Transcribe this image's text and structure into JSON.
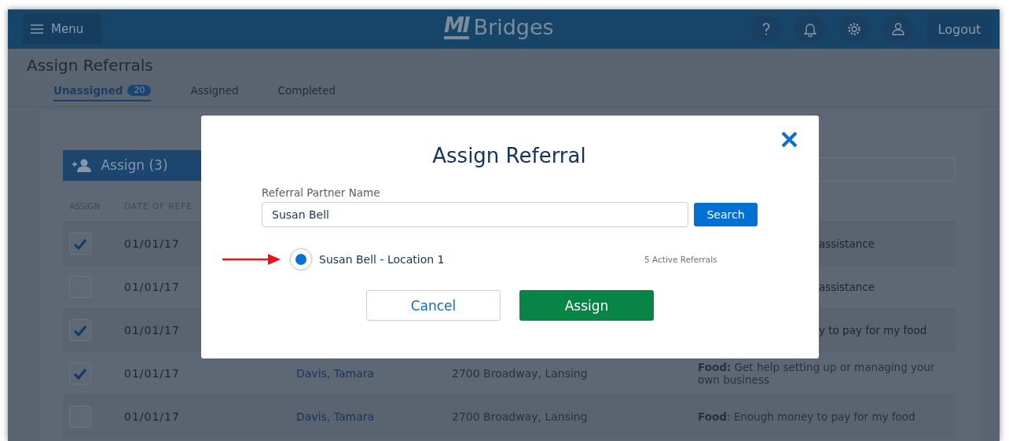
{
  "header": {
    "menu_label": "Menu",
    "logo": {
      "mark": "MI",
      "name": "Bridges"
    },
    "logout_label": "Logout"
  },
  "page_title": "Assign Referrals",
  "tabs": [
    {
      "label": "Unassigned",
      "badge": "20",
      "selected": true
    },
    {
      "label": "Assigned",
      "selected": false
    },
    {
      "label": "Completed",
      "selected": false
    }
  ],
  "assign_button": "Assign (3)",
  "table": {
    "columns": [
      "ASSIGN",
      "DATE OF REFE"
    ],
    "rows": [
      {
        "kind": "partly_hidden",
        "checked": true,
        "date": "01/01/17",
        "description": "assistance"
      },
      {
        "kind": "partly_hidden",
        "checked": false,
        "date": "01/01/17",
        "description": "assistance"
      },
      {
        "kind": "partly_hidden",
        "checked": true,
        "date": "01/01/17",
        "description": "y to pay for my food"
      },
      {
        "kind": "full",
        "checked": true,
        "date": "01/01/17",
        "name": "Davis, Tamara",
        "address": "2700 Broadway, Lansing",
        "description": "**Food:** Get help setting up or managing your own business"
      },
      {
        "kind": "full",
        "checked": false,
        "date": "01/01/17",
        "name": "Davis, Tamara",
        "address": "2700 Broadway, Lansing",
        "description": "**Food**: Enough money to pay for my food"
      }
    ]
  },
  "dialog": {
    "title": "Assign Referral",
    "field_label": "Referral Partner Name",
    "field_value": "Susan Bell",
    "search_label": "Search",
    "results": [
      {
        "label": "Susan Bell - Location 1",
        "count": "5 Active Referrals",
        "selected": true
      }
    ],
    "cancel_label": "Cancel",
    "assign_label": "Assign"
  }
}
